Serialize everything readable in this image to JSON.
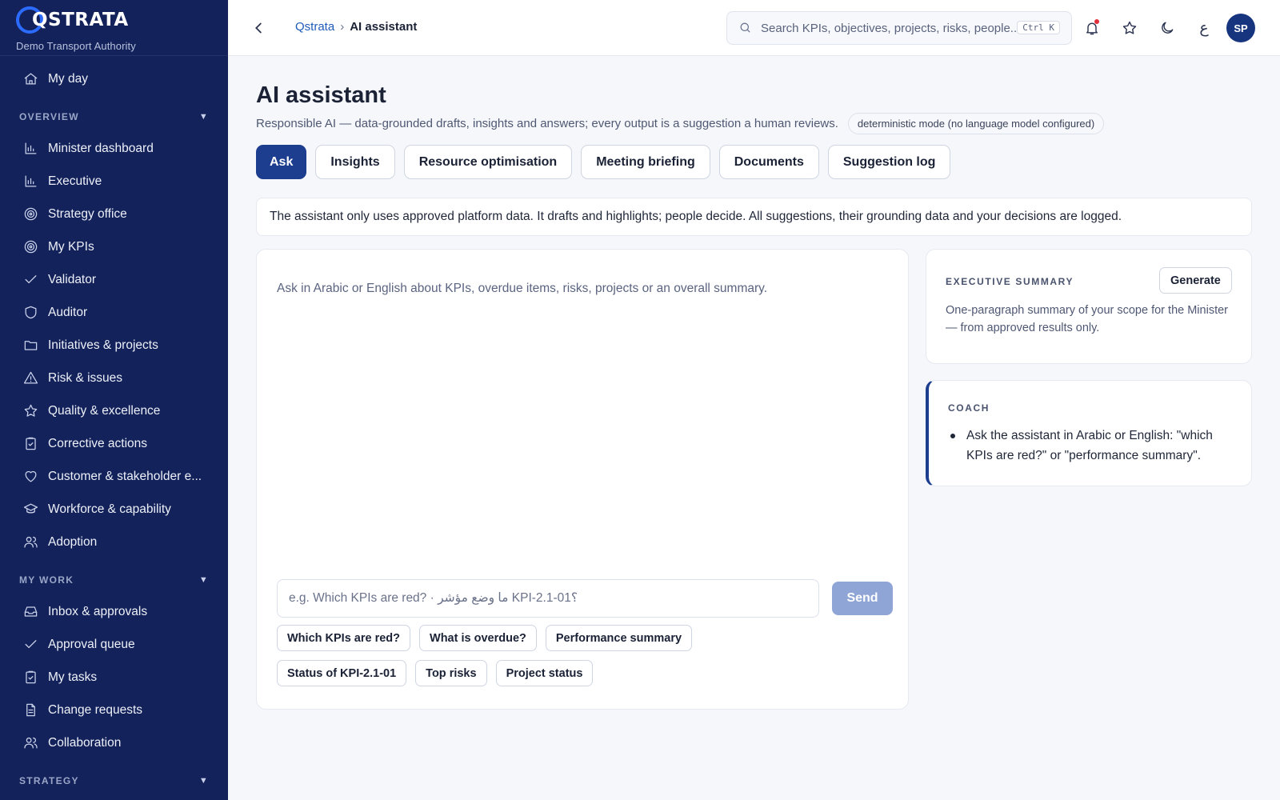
{
  "brand": {
    "name": "QSTRATA",
    "org": "Demo Transport Authority"
  },
  "nav_top": [
    {
      "label": "My day",
      "icon": "home-icon"
    }
  ],
  "sections": {
    "overview": {
      "label": "OVERVIEW",
      "items": [
        {
          "label": "Minister dashboard",
          "icon": "bar-chart-icon"
        },
        {
          "label": "Executive",
          "icon": "bar-chart-icon"
        },
        {
          "label": "Strategy office",
          "icon": "target-icon"
        },
        {
          "label": "My KPIs",
          "icon": "target-icon"
        },
        {
          "label": "Validator",
          "icon": "check-icon"
        },
        {
          "label": "Auditor",
          "icon": "shield-icon"
        },
        {
          "label": "Initiatives & projects",
          "icon": "folder-icon"
        },
        {
          "label": "Risk & issues",
          "icon": "warning-icon"
        },
        {
          "label": "Quality & excellence",
          "icon": "star-icon"
        },
        {
          "label": "Corrective actions",
          "icon": "clipboard-check-icon"
        },
        {
          "label": "Customer & stakeholder e...",
          "icon": "heart-icon"
        },
        {
          "label": "Workforce & capability",
          "icon": "graduation-cap-icon"
        },
        {
          "label": "Adoption",
          "icon": "users-icon"
        }
      ]
    },
    "my_work": {
      "label": "MY WORK",
      "items": [
        {
          "label": "Inbox & approvals",
          "icon": "inbox-icon"
        },
        {
          "label": "Approval queue",
          "icon": "check-icon"
        },
        {
          "label": "My tasks",
          "icon": "clipboard-check-icon"
        },
        {
          "label": "Change requests",
          "icon": "file-icon"
        },
        {
          "label": "Collaboration",
          "icon": "users-icon"
        }
      ]
    },
    "strategy": {
      "label": "STRATEGY"
    }
  },
  "topbar": {
    "breadcrumb_root": "Qstrata",
    "breadcrumb_sep": "›",
    "breadcrumb_current": "AI assistant",
    "search_placeholder": "Search KPIs, objectives, projects, risks, people...",
    "search_shortcut": "Ctrl K",
    "lang_toggle": "ع",
    "avatar_initials": "SP"
  },
  "page": {
    "title": "AI assistant",
    "subtitle": "Responsible AI — data-grounded drafts, insights and answers; every output is a suggestion a human reviews.",
    "mode_badge": "deterministic mode (no language model configured)",
    "tabs": [
      "Ask",
      "Insights",
      "Resource optimisation",
      "Meeting briefing",
      "Documents",
      "Suggestion log"
    ],
    "notice": "The assistant only uses approved platform data. It drafts and highlights; people decide. All suggestions, their grounding data and your decisions are logged."
  },
  "chat": {
    "empty_hint": "Ask in Arabic or English about KPIs, overdue items, risks, projects or an overall summary.",
    "input_placeholder": "e.g. Which KPIs are red? · ما وضع مؤشر KPI-2.1-01؟",
    "send_label": "Send",
    "suggestions": [
      "Which KPIs are red?",
      "What is overdue?",
      "Performance summary",
      "Status of KPI-2.1-01",
      "Top risks",
      "Project status"
    ]
  },
  "summary": {
    "label": "EXECUTIVE SUMMARY",
    "generate_label": "Generate",
    "description": "One-paragraph summary of your scope for the Minister — from approved results only."
  },
  "coach": {
    "label": "COACH",
    "tips": [
      "Ask the assistant in Arabic or English: \"which KPIs are red?\" or \"performance summary\"."
    ]
  },
  "colors": {
    "sidebar_bg": "#13225a",
    "accent": "#1d3d8f",
    "send_disabled": "#8fa5d6",
    "notif_dot": "#e0303d"
  }
}
